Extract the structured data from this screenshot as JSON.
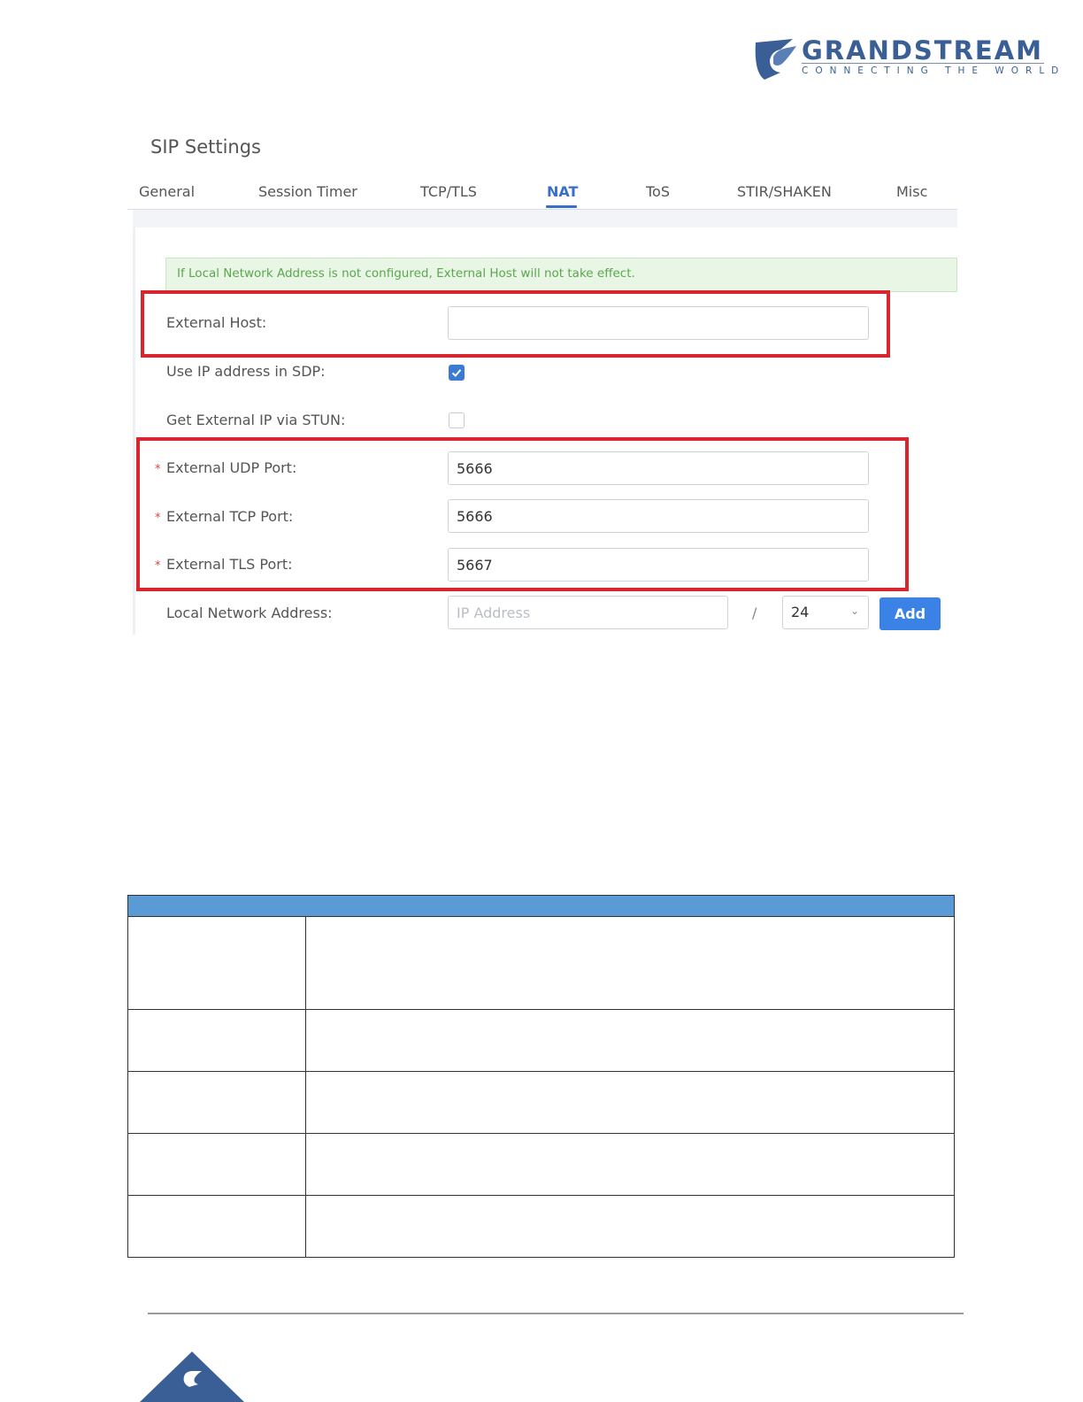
{
  "brand": {
    "name": "GRANDSTREAM",
    "tagline": "CONNECTING THE WORLD",
    "logo_icon": "grandstream-logo-icon",
    "color": "#3a5f96"
  },
  "panel": {
    "title": "SIP Settings",
    "tabs": [
      "General",
      "Session Timer",
      "TCP/TLS",
      "NAT",
      "ToS",
      "STIR/SHAKEN",
      "Misc"
    ],
    "active_tab": "NAT",
    "notice": "If Local Network Address is not configured, External Host will not take effect."
  },
  "form": {
    "external_host": {
      "label": "External Host:",
      "value": ""
    },
    "use_ip_in_sdp": {
      "label": "Use IP address in SDP:",
      "checked": true
    },
    "stun": {
      "label": "Get External IP via STUN:",
      "checked": false
    },
    "udp_port": {
      "required_mark": "*",
      "label": "External UDP Port:",
      "value": "5666"
    },
    "tcp_port": {
      "required_mark": "*",
      "label": "External TCP Port:",
      "value": "5666"
    },
    "tls_port": {
      "required_mark": "*",
      "label": "External TLS Port:",
      "value": "5667"
    },
    "local_network": {
      "label": "Local Network Address:",
      "placeholder": "IP Address",
      "separator": "/",
      "mask": "24",
      "add_label": "Add"
    }
  },
  "colors": {
    "accent": "#3a6fc9",
    "highlight": "#d8262f",
    "table_header": "#5b9bd5",
    "button": "#3b82e6"
  }
}
